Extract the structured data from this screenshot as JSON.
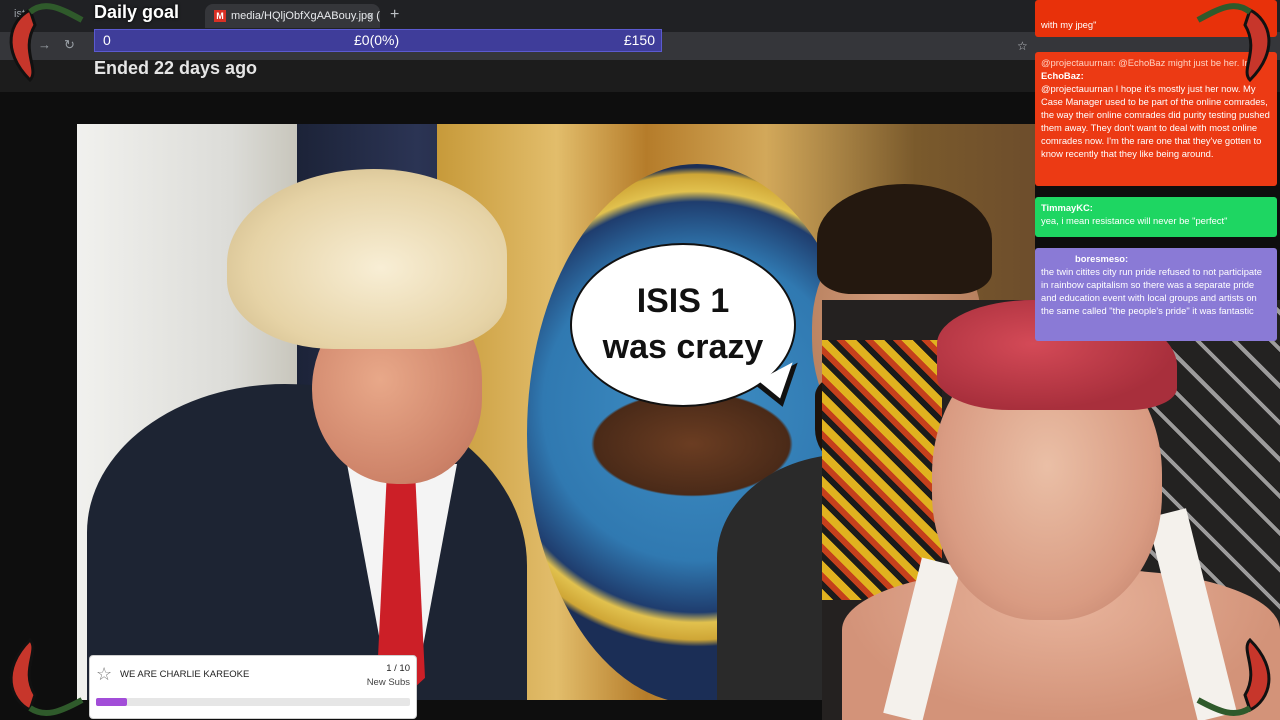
{
  "browser": {
    "tab_left_fragment": "ist",
    "active_tab_label": "media/HQljObfXgAABouy.jpg (",
    "active_tab_close": "×",
    "new_tab": "+",
    "back": "←",
    "forward": "→",
    "reload": "↻",
    "bookmark_star": "☆"
  },
  "daily_goal": {
    "title": "Daily goal",
    "min_label": "0",
    "current_label": "£0(0%)",
    "max_label": "£150",
    "progress_percent": 0,
    "status": "Ended 22 days ago"
  },
  "speech_bubble": {
    "line1": "ISIS 1",
    "line2": "was crazy"
  },
  "chat": {
    "top_message_fragment": "with my jpeg\"",
    "echobaz": {
      "reply_context": "@projectauurnan: @EchoBaz might just be her. In",
      "username": "EchoBaz:",
      "message": "@projectauurnan I hope it's mostly just her now. My Case Manager used to be part of the online comrades, the way their online comrades did purity testing pushed them away. They don't want to deal with most online comrades now. I'm the rare one that they've gotten to know recently that they like being around."
    },
    "timmy": {
      "username": "TimmayKC:",
      "message": "yea, i mean resistance will never be \"perfect\""
    },
    "boresmeso": {
      "username": "boresmeso:",
      "message": "the twin citites city run pride refused to not participate in rainbow capitalism so there was a separate pride and education event with local groups and artists on the same called \"the people's pride\" it was fantastic"
    }
  },
  "sub_goal": {
    "title": "WE ARE CHARLIE KAREOKE",
    "count": "1 / 10",
    "label": "New Subs",
    "progress_fraction": 0.1,
    "fill_color": "#a24dd8"
  },
  "colors": {
    "goal_bar": "#3f3d9a",
    "chat_red": "#ec3a14",
    "chat_green": "#1ed662",
    "chat_purple": "#8a7ad6"
  }
}
